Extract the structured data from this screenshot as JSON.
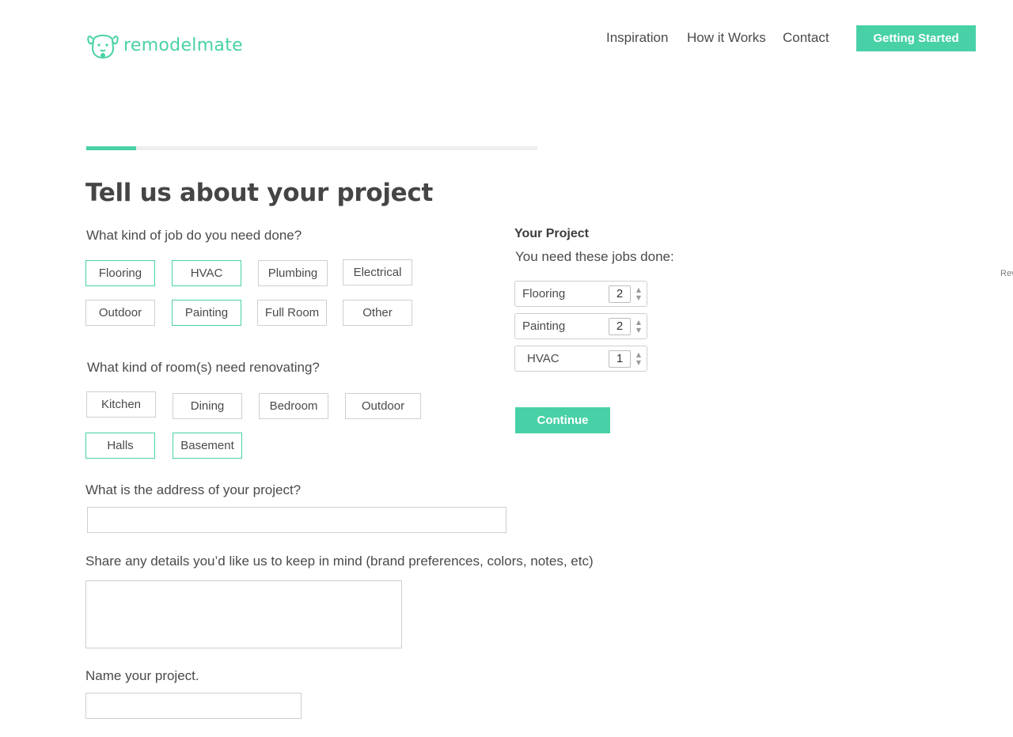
{
  "brand": {
    "name": "remodelmate",
    "accent": "#48d1a6"
  },
  "nav": {
    "items": [
      "Inspiration",
      "How it Works",
      "Contact"
    ],
    "cta": "Getting Started"
  },
  "progress": {
    "fraction": 0.11
  },
  "page": {
    "title": "Tell us about your project"
  },
  "jobs": {
    "question": "What kind of job do you need done?",
    "options": [
      {
        "label": "Flooring",
        "selected": true
      },
      {
        "label": "HVAC",
        "selected": true
      },
      {
        "label": "Plumbing",
        "selected": false
      },
      {
        "label": "Electrical",
        "selected": false
      },
      {
        "label": "Outdoor",
        "selected": false
      },
      {
        "label": "Painting",
        "selected": true
      },
      {
        "label": "Full Room",
        "selected": false
      },
      {
        "label": "Other",
        "selected": false
      }
    ]
  },
  "rooms": {
    "question": "What kind of room(s) need renovating?",
    "options": [
      {
        "label": "Kitchen",
        "selected": false
      },
      {
        "label": "Dining",
        "selected": false
      },
      {
        "label": "Bedroom",
        "selected": false
      },
      {
        "label": "Outdoor",
        "selected": false
      },
      {
        "label": "Halls",
        "selected": true
      },
      {
        "label": "Basement",
        "selected": true
      }
    ]
  },
  "address": {
    "question": "What is the address of your project?",
    "value": "",
    "placeholder": ""
  },
  "details": {
    "question": "Share any details you’d like us to keep in mind (brand preferences, colors, notes, etc)",
    "value": ""
  },
  "project_name": {
    "question": "Name your project.",
    "value": ""
  },
  "summary": {
    "title": "Your Project",
    "subtitle": "You need these jobs done:",
    "jobs": [
      {
        "label": "Flooring",
        "qty": "2"
      },
      {
        "label": "Painting",
        "qty": "2"
      },
      {
        "label": "HVAC",
        "qty": "1"
      }
    ],
    "continue_label": "Continue"
  },
  "edge_text": "Rev"
}
